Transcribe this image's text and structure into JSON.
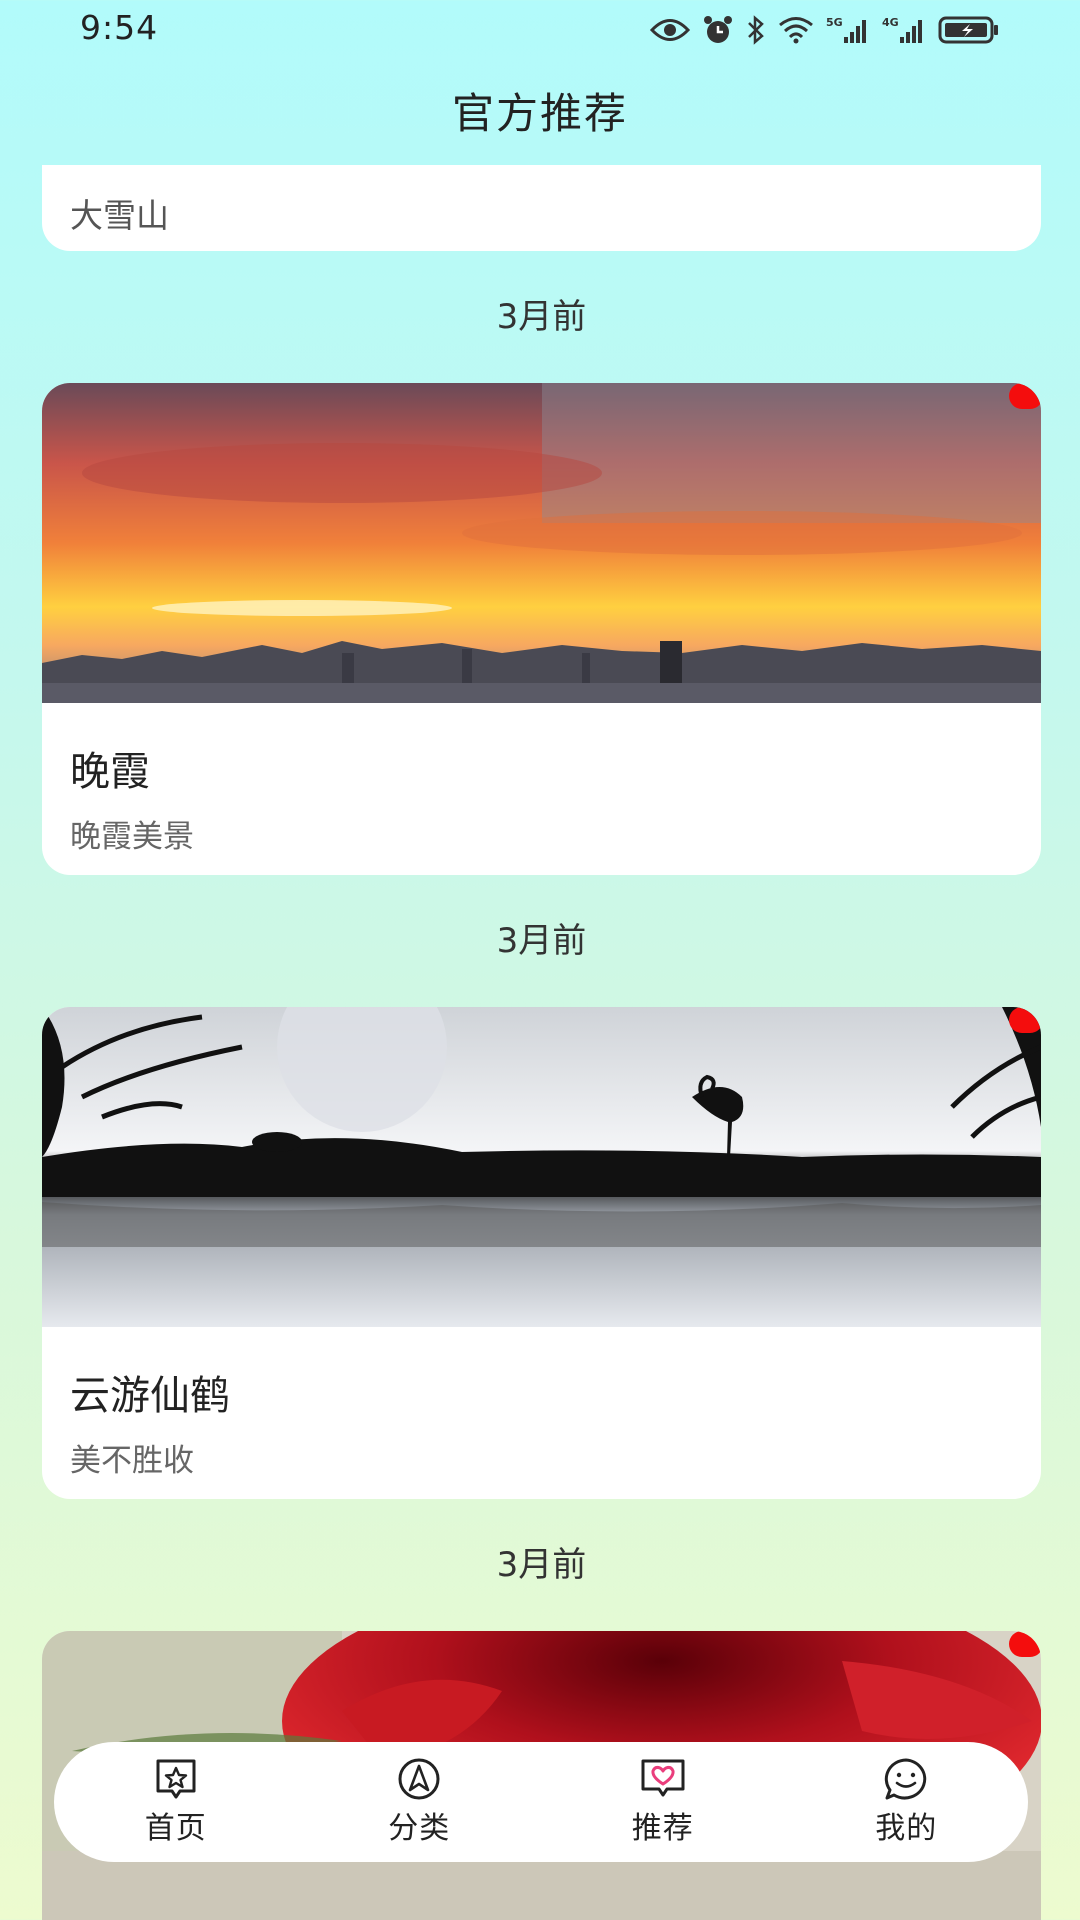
{
  "status_bar": {
    "time": "9:54",
    "icons": [
      "eye-icon",
      "alarm-icon",
      "bluetooth-icon",
      "wifi-icon",
      "signal-5g-icon",
      "signal-4g-icon",
      "battery-charging-icon"
    ],
    "net1": "5G",
    "net2": "4G"
  },
  "header": {
    "title": "官方推荐"
  },
  "feed": {
    "partial_card_title": "大雪山",
    "items": [
      {
        "time": "3月前",
        "title": "晚霞",
        "subtitle": "晚霞美景",
        "image": "sunset-city-image",
        "unread": true
      },
      {
        "time": "3月前",
        "title": "云游仙鹤",
        "subtitle": "美不胜收",
        "image": "flamingo-lake-image",
        "unread": true
      },
      {
        "time": "3月前",
        "image": "red-rose-image",
        "unread": true
      }
    ]
  },
  "bottom_nav": {
    "items": [
      {
        "label": "首页",
        "icon": "home-star-icon",
        "active": false
      },
      {
        "label": "分类",
        "icon": "compass-icon",
        "active": false
      },
      {
        "label": "推荐",
        "icon": "heart-message-icon",
        "active": true
      },
      {
        "label": "我的",
        "icon": "smile-chat-icon",
        "active": false
      }
    ]
  },
  "colors": {
    "unread_dot": "#f40d0d",
    "active_nav_icon": "#ea3e7c",
    "bg_top": "#b2fbfb",
    "bg_bottom": "#edfbcf"
  }
}
